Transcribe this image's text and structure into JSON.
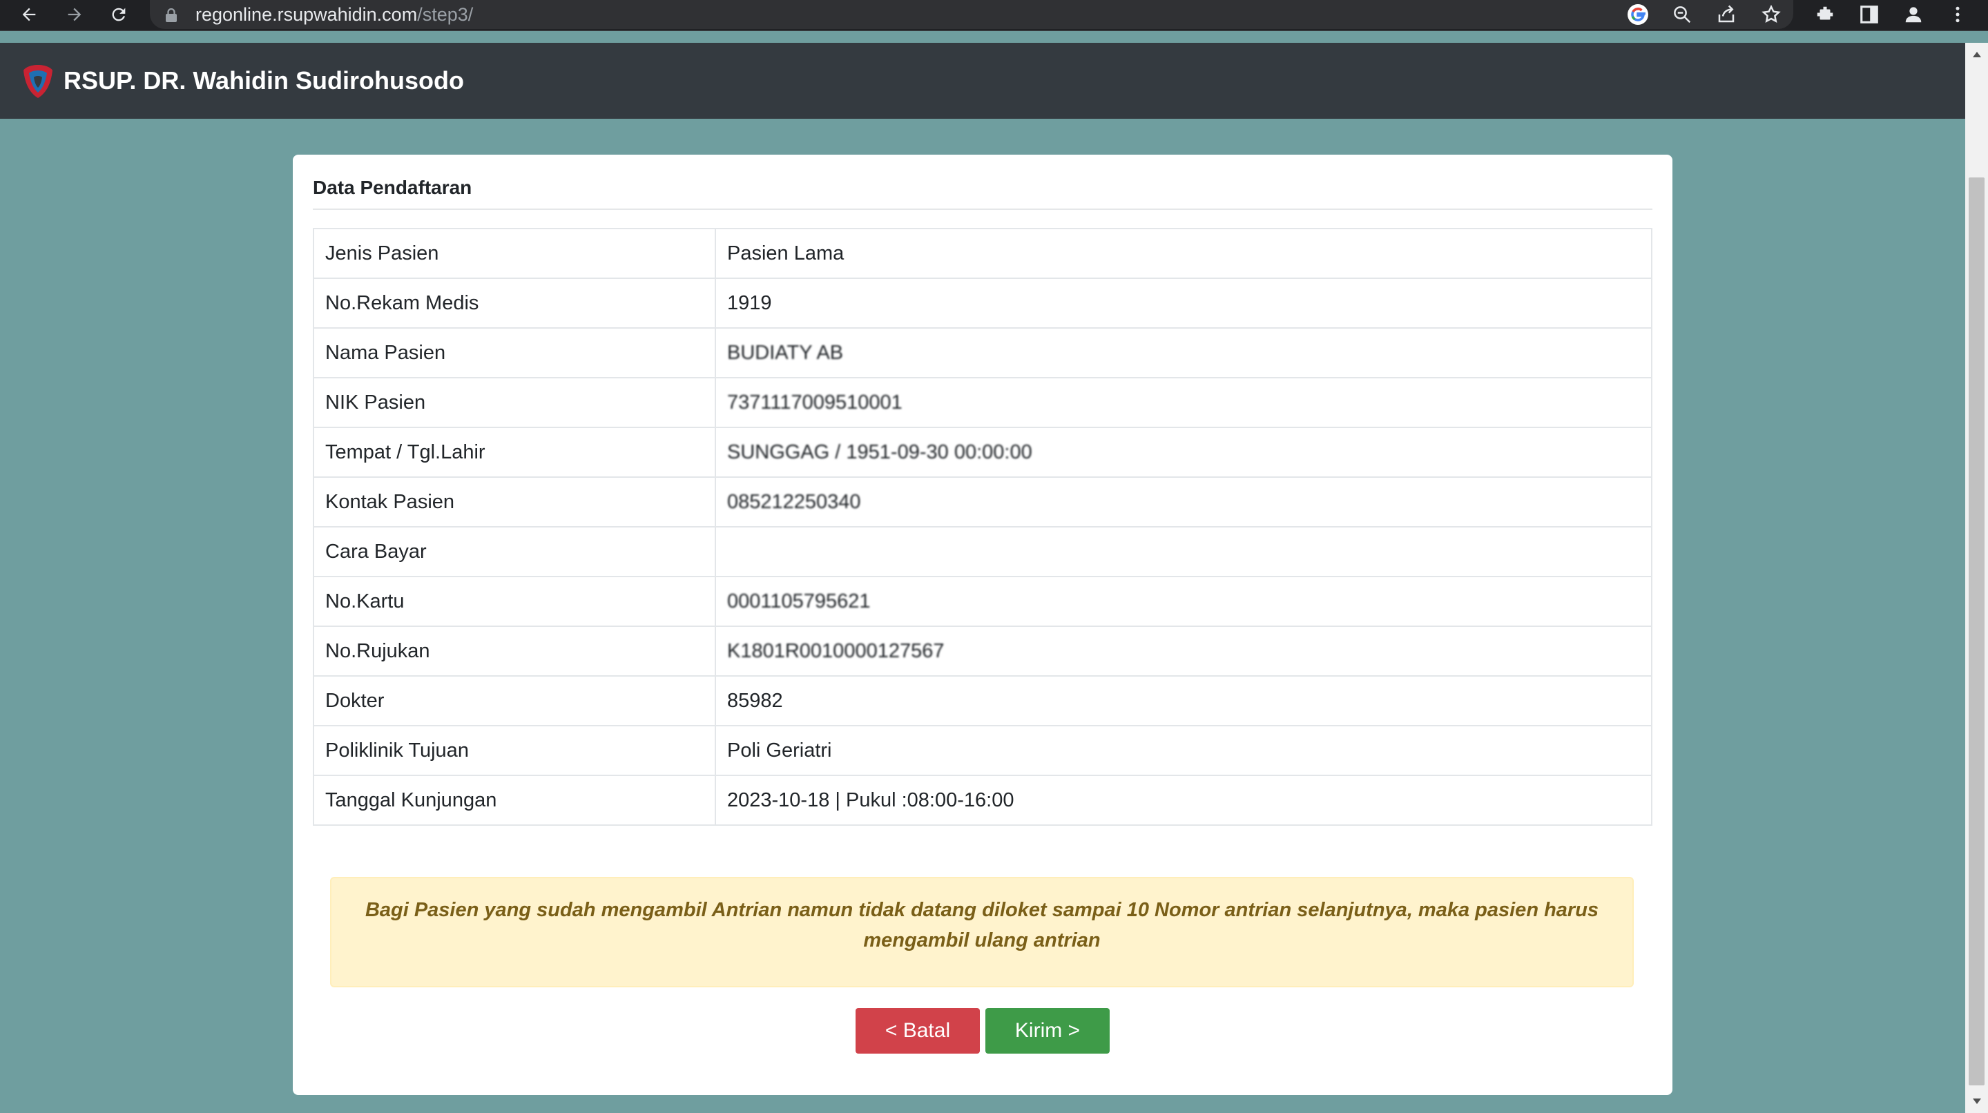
{
  "browser": {
    "url_host": "regonline.rsupwahidin.com",
    "url_path": "/step3/"
  },
  "site": {
    "brand": "RSUP. DR. Wahidin Sudirohusodo"
  },
  "card": {
    "title": "Data Pendaftaran",
    "rows": [
      {
        "label": "Jenis Pasien",
        "value": "Pasien Lama"
      },
      {
        "label": "No.Rekam Medis",
        "value": "1919"
      },
      {
        "label": "Nama Pasien",
        "value": "BUDIATY AB"
      },
      {
        "label": "NIK Pasien",
        "value": "7371117009510001"
      },
      {
        "label": "Tempat / Tgl.Lahir",
        "value": "SUNGGAG / 1951-09-30 00:00:00"
      },
      {
        "label": "Kontak Pasien",
        "value": "085212250340"
      },
      {
        "label": "Cara Bayar",
        "value": ""
      },
      {
        "label": "No.Kartu",
        "value": "0001105795621"
      },
      {
        "label": "No.Rujukan",
        "value": "K1801R0010000127567"
      },
      {
        "label": "Dokter",
        "value": "85982"
      },
      {
        "label": "Poliklinik Tujuan",
        "value": "Poli Geriatri"
      },
      {
        "label": "Tanggal Kunjungan",
        "value": "2023-10-18 | Pukul :08:00-16:00"
      }
    ],
    "alert": "Bagi Pasien yang sudah mengambil Antrian namun tidak datang diloket sampai 10 Nomor antrian selanjutnya, maka pasien harus mengambil ulang antrian",
    "cancel_label": "< Batal",
    "send_label": "Kirim >"
  },
  "colors": {
    "page_background": "#6f9e9f",
    "navbar": "#343a40",
    "cancel_button": "#d1424a",
    "send_button": "#3e9b48",
    "alert_background": "#fff3cd",
    "alert_text": "#7a5f18"
  },
  "icons": [
    "back-arrow-icon",
    "forward-arrow-icon",
    "reload-icon",
    "lock-icon",
    "google-icon",
    "zoom-icon",
    "share-icon",
    "bookmark-star-icon",
    "extensions-icon",
    "side-panel-icon",
    "profile-icon",
    "more-menu-icon",
    "hospital-logo-icon"
  ]
}
